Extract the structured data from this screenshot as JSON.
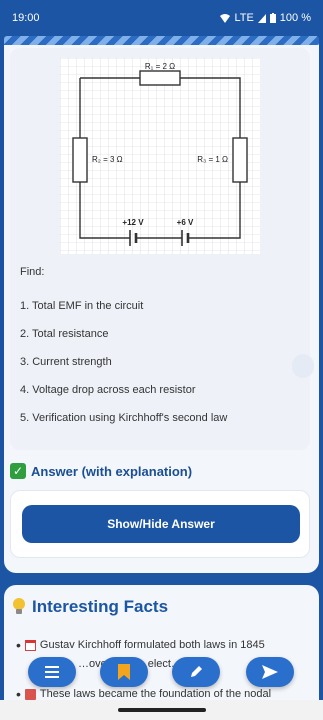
{
  "status_bar": {
    "time": "19:00",
    "network": "LTE",
    "battery": "100 %"
  },
  "circuit": {
    "r_top": "R₁ = 2 Ω",
    "r_left": "R₂ = 3 Ω",
    "r_right": "R₃ = 1 Ω",
    "emf1": "+12 V",
    "emf2": "+6 V"
  },
  "problem": {
    "find_label": "Find:",
    "tasks": [
      "1. Total EMF in the circuit",
      "2. Total resistance",
      "3. Current strength",
      "4. Voltage drop across each resistor",
      "5. Verification using Kirchhoff's second law"
    ]
  },
  "answer": {
    "heading": "Answer (with explanation)",
    "toggle_label": "Show/Hide Answer"
  },
  "facts": {
    "title": "Interesting Facts",
    "items": [
      "Gustav Kirchhoff formulated both laws in 1845",
      "These laws became the foundation of the nodal"
    ],
    "partial_line": "…fore… …overed… …elect…"
  },
  "colors": {
    "primary": "#1b55a3",
    "accent": "#2a6fcb",
    "success": "#2e9e3e"
  },
  "fab_icons": [
    "menu-icon",
    "bookmark-icon",
    "pencil-icon",
    "send-icon"
  ]
}
